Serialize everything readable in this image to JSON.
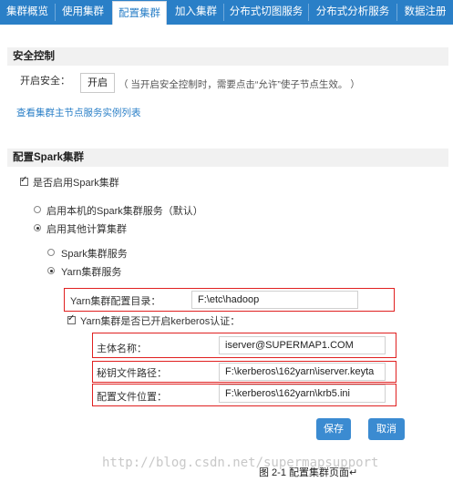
{
  "tabs": [
    {
      "label": "集群概览"
    },
    {
      "label": "使用集群"
    },
    {
      "label": "配置集群"
    },
    {
      "label": "加入集群"
    },
    {
      "label": "分布式切图服务"
    },
    {
      "label": "分布式分析服务"
    },
    {
      "label": "数据注册"
    }
  ],
  "security": {
    "title": "安全控制",
    "enable_label": "开启安全：",
    "enable_button": "开启",
    "hint": "（ 当开启安全控制时，需要点击“允许”使子节点生效。 ）",
    "link": "查看集群主节点服务实例列表"
  },
  "spark": {
    "title": "配置Spark集群",
    "enable_label": "是否启用Spark集群",
    "option_local": "启用本机的Spark集群服务（默认）",
    "option_other": "启用其他计算集群",
    "sub_spark": "Spark集群服务",
    "sub_yarn": "Yarn集群服务",
    "yarn_dir_label": "Yarn集群配置目录：",
    "yarn_dir_value": "F:\\etc\\hadoop",
    "kerberos_label": "Yarn集群是否已开启kerberos认证：",
    "principal_label": "主体名称：",
    "principal_value": "iserver@SUPERMAP1.COM",
    "keytab_label": "秘钥文件路径：",
    "keytab_value": "F:\\kerberos\\162yarn\\iserver.keyta",
    "config_label": "配置文件位置：",
    "config_value": "F:\\kerberos\\162yarn\\krb5.ini"
  },
  "buttons": {
    "save": "保存",
    "cancel": "取消"
  },
  "watermark": "http://blog.csdn.net/supermapsupport",
  "caption": "图 2-1 配置集群页面↵"
}
